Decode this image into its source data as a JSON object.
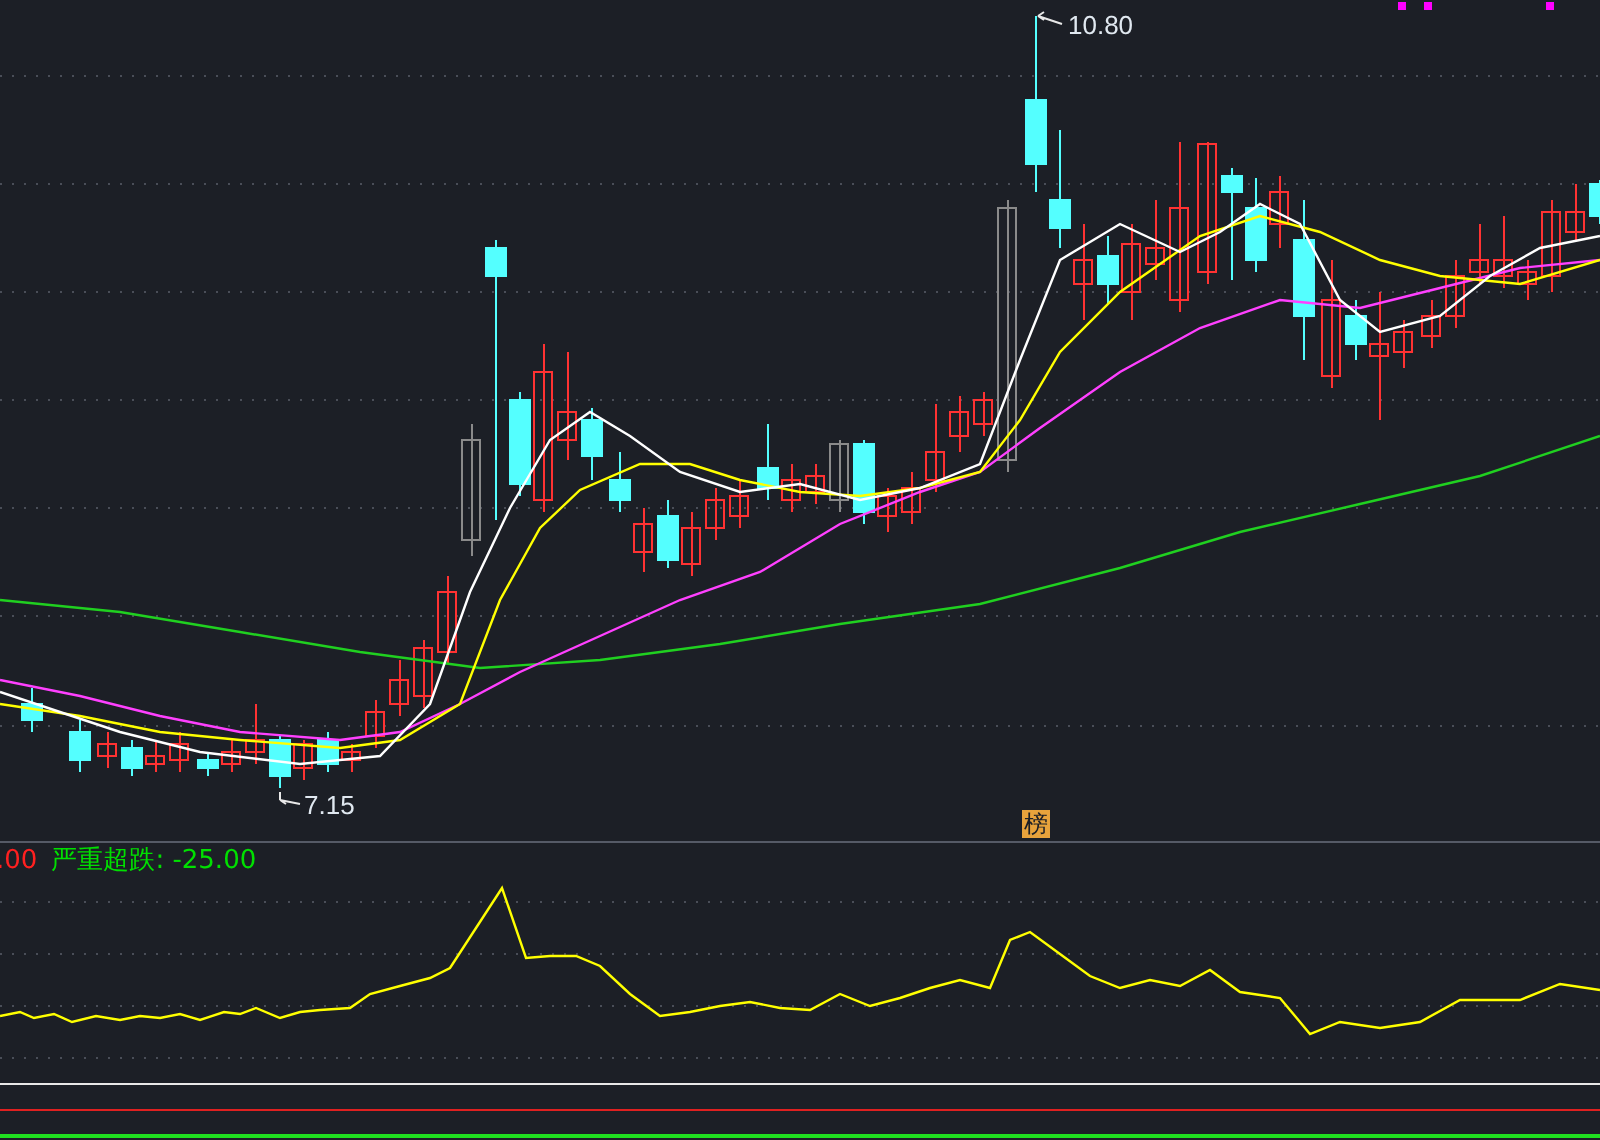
{
  "main_chart": {
    "high_label": "10.80",
    "low_label": "7.15",
    "marker": "榜"
  },
  "indicator": {
    "legend": [
      {
        "text": ".00",
        "color": "#ff2020"
      },
      {
        "text": "严重超跌: -25.00",
        "color": "#00e000"
      }
    ]
  }
}
